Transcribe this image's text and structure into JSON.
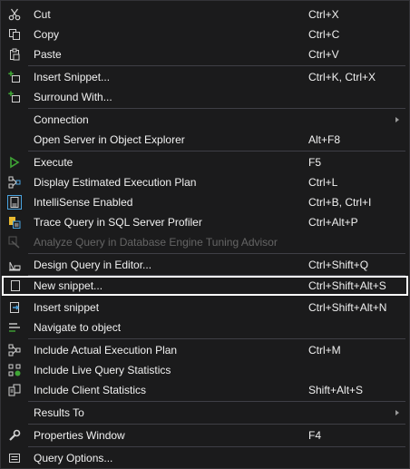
{
  "menu": {
    "cut": {
      "label": "Cut",
      "shortcut": "Ctrl+X",
      "icon": "scissors-icon"
    },
    "copy": {
      "label": "Copy",
      "shortcut": "Ctrl+C",
      "icon": "copy-icon"
    },
    "paste": {
      "label": "Paste",
      "shortcut": "Ctrl+V",
      "icon": "paste-icon"
    },
    "insert_snippet_1": {
      "label": "Insert Snippet...",
      "shortcut": "Ctrl+K, Ctrl+X",
      "icon": "insert-snippet-icon"
    },
    "surround_with": {
      "label": "Surround With...",
      "shortcut": "",
      "icon": "surround-with-icon"
    },
    "connection": {
      "label": "Connection",
      "shortcut": ""
    },
    "open_server": {
      "label": "Open Server in Object Explorer",
      "shortcut": "Alt+F8"
    },
    "execute": {
      "label": "Execute",
      "shortcut": "F5",
      "icon": "play-icon"
    },
    "display_plan": {
      "label": "Display Estimated Execution Plan",
      "shortcut": "Ctrl+L",
      "icon": "execution-plan-icon"
    },
    "intellisense": {
      "label": "IntelliSense Enabled",
      "shortcut": "Ctrl+B, Ctrl+I",
      "icon": "intellisense-icon"
    },
    "trace_query": {
      "label": "Trace Query in SQL Server Profiler",
      "shortcut": "Ctrl+Alt+P",
      "icon": "profiler-icon"
    },
    "analyze_query": {
      "label": "Analyze Query in Database Engine Tuning Advisor",
      "shortcut": "",
      "icon": "tuning-advisor-icon",
      "disabled": true
    },
    "design_query": {
      "label": "Design Query in Editor...",
      "shortcut": "Ctrl+Shift+Q",
      "icon": "design-query-icon"
    },
    "new_snippet": {
      "label": "New snippet...",
      "shortcut": "Ctrl+Shift+Alt+S",
      "icon": "new-snippet-icon",
      "highlighted": true
    },
    "insert_snippet_2": {
      "label": "Insert snippet",
      "shortcut": "Ctrl+Shift+Alt+N",
      "icon": "insert-snippet-2-icon"
    },
    "navigate": {
      "label": "Navigate to object",
      "shortcut": "",
      "icon": "navigate-icon"
    },
    "include_actual": {
      "label": "Include Actual Execution Plan",
      "shortcut": "Ctrl+M",
      "icon": "actual-plan-icon"
    },
    "include_live": {
      "label": "Include Live Query Statistics",
      "shortcut": "",
      "icon": "live-stats-icon"
    },
    "include_client": {
      "label": "Include Client Statistics",
      "shortcut": "Shift+Alt+S",
      "icon": "client-stats-icon"
    },
    "results_to": {
      "label": "Results To",
      "shortcut": ""
    },
    "properties": {
      "label": "Properties Window",
      "shortcut": "F4",
      "icon": "wrench-icon"
    },
    "query_options": {
      "label": "Query Options...",
      "shortcut": "",
      "icon": "query-options-icon"
    }
  },
  "colors": {
    "background": "#1b1b1c",
    "text": "#f1f1f1",
    "disabled": "#656565",
    "separator": "#3f3f46",
    "accent_green": "#3fa535",
    "accent_blue": "#4aa3df",
    "highlight_border": "#ffffff"
  }
}
